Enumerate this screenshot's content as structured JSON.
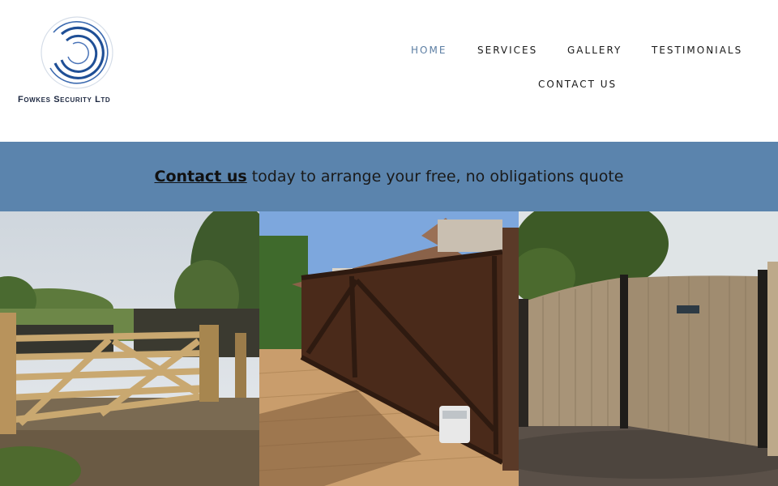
{
  "brand": {
    "name": "Fowkes Security Ltd",
    "accent": "#5b84ad",
    "logo_color": "#1f4f96"
  },
  "nav": {
    "items": [
      {
        "label": "HOME",
        "active": true
      },
      {
        "label": "SERVICES"
      },
      {
        "label": "GALLERY"
      },
      {
        "label": "TESTIMONIALS"
      },
      {
        "label": "CONTACT US"
      }
    ]
  },
  "banner": {
    "link_text": "Contact us",
    "text": "today to arrange your free, no obligations quote"
  },
  "gallery": {
    "photos": [
      {
        "subject": "wooden-field-gate"
      },
      {
        "subject": "electric-sliding-gate"
      },
      {
        "subject": "wooden-panel-gates"
      }
    ]
  }
}
